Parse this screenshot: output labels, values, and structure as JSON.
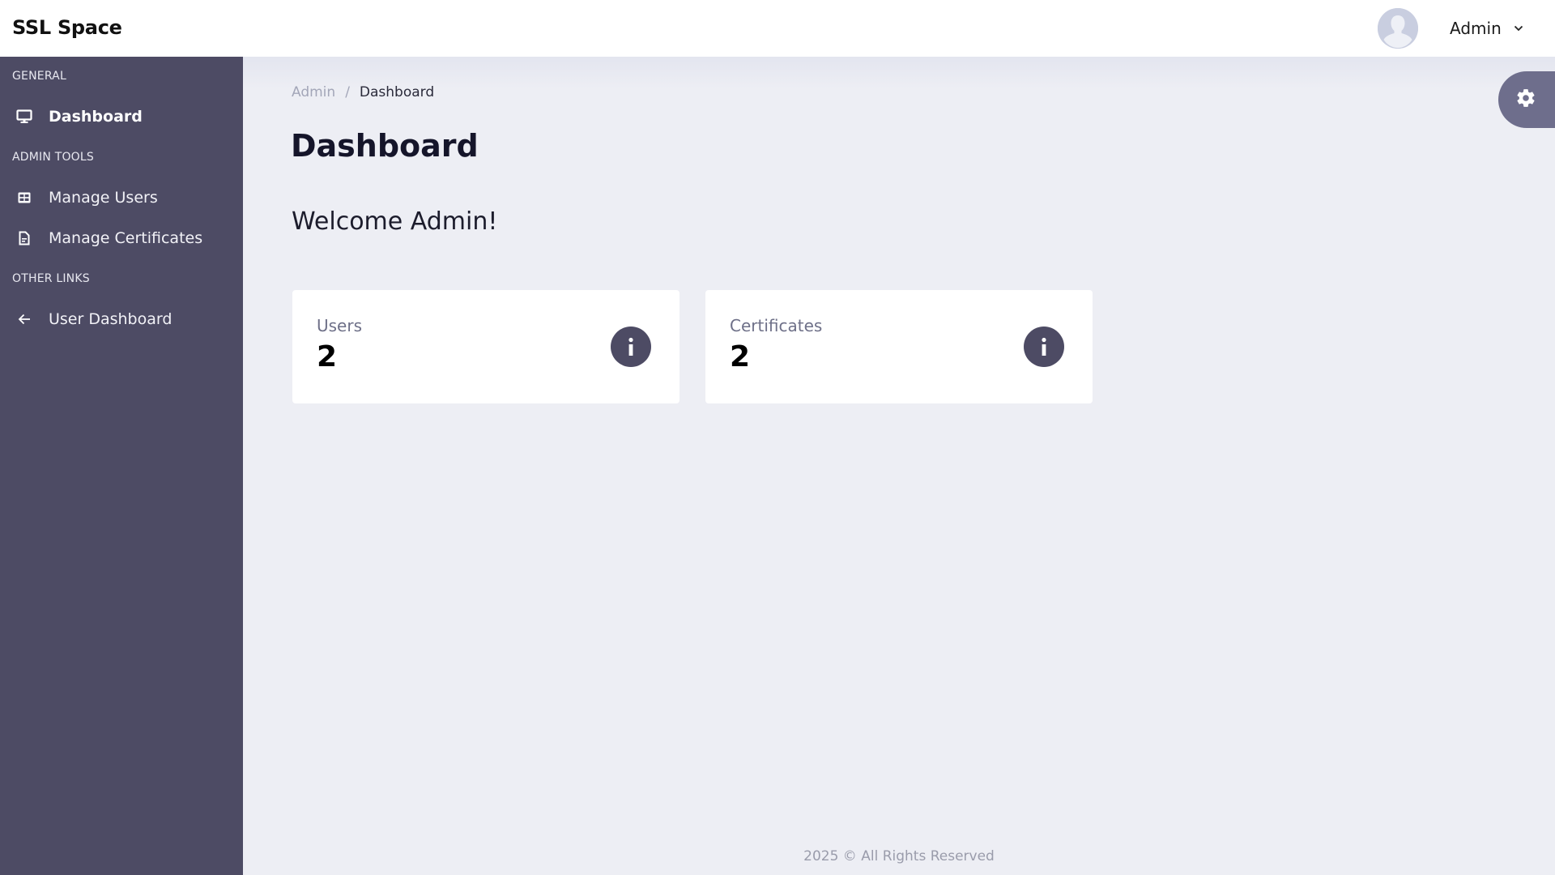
{
  "header": {
    "brand": "SSL Space",
    "user_name": "Admin",
    "avatar_icon": "user-silhouette-icon",
    "dropdown_icon": "chevron-down-icon"
  },
  "sidebar": {
    "sections": [
      {
        "label": "GENERAL"
      },
      {
        "label": "ADMIN TOOLS"
      },
      {
        "label": "OTHER LINKS"
      }
    ],
    "items": [
      {
        "label": "Dashboard",
        "icon": "monitor-icon",
        "active": true
      },
      {
        "label": "Manage Users",
        "icon": "table-icon",
        "active": false
      },
      {
        "label": "Manage Certificates",
        "icon": "document-icon",
        "active": false
      },
      {
        "label": "User Dashboard",
        "icon": "arrow-left-icon",
        "active": false
      }
    ]
  },
  "breadcrumb": {
    "items": [
      "Admin",
      "Dashboard"
    ],
    "separator": "/"
  },
  "page": {
    "title": "Dashboard",
    "welcome": "Welcome Admin!"
  },
  "stats": [
    {
      "label": "Users",
      "value": "2",
      "icon": "info-icon"
    },
    {
      "label": "Certificates",
      "value": "2",
      "icon": "info-icon"
    }
  ],
  "settings_button": {
    "icon": "gear-icon"
  },
  "footer": {
    "text": "2025 © All Rights Reserved"
  },
  "colors": {
    "sidebar_bg": "#4d4b64",
    "accent": "#4d4b64",
    "settings_bg": "#6e6e8c",
    "page_bg": "#edeef4"
  }
}
